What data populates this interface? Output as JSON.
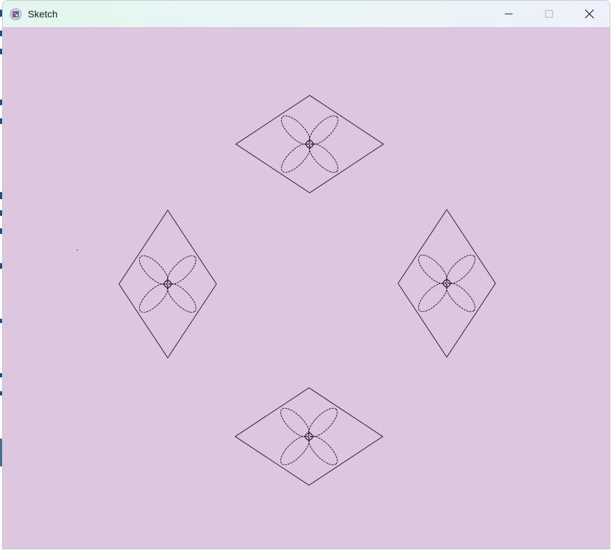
{
  "window": {
    "title": "Sketch",
    "app_icon": "processing-sketch-icon",
    "background_color": "#dcc6e0",
    "stroke_color": "#3a2a3a"
  },
  "controls": {
    "minimize_icon": "minimize-icon",
    "maximize_icon": "maximize-icon",
    "close_icon": "close-icon"
  },
  "canvas": {
    "motif_count": 4,
    "motif": "diamond-with-four-petal-flower"
  }
}
